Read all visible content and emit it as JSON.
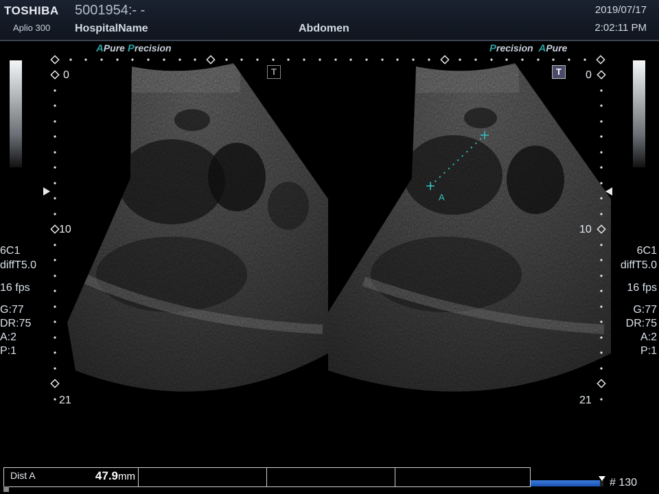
{
  "header": {
    "brand": "TOSHIBA",
    "model": "Aplio 300",
    "patient_id": "5001954:- -",
    "hospital": "HospitalName",
    "exam": "Abdomen",
    "date": "2019/07/17",
    "time": "2:02:11 PM"
  },
  "presets": {
    "left": {
      "a": "A",
      "pure": "Pure",
      "p": "P",
      "recision": "recision"
    },
    "right": {
      "p": "P",
      "recision": "recision",
      "a": "A",
      "pure": "Pure"
    }
  },
  "depth_scale": {
    "top": "0",
    "mid": "10",
    "bottom": "21"
  },
  "t_icon": "T",
  "params": {
    "transducer": "6C1",
    "mode": "diffT5.0",
    "fps": "16 fps",
    "gain": "G:77",
    "dynamic_range": "DR:75",
    "a": "A:2",
    "p": "P:1"
  },
  "measurement": {
    "marker_label": "A",
    "name": "Dist A",
    "value": "47.9",
    "unit": "mm"
  },
  "cine": {
    "frame_label": "# 130",
    "progress": 0.95
  },
  "colors": {
    "accent_teal": "#2aa0a0",
    "caliper": "#35c0c0",
    "cine_blue": "#2a66d0"
  }
}
